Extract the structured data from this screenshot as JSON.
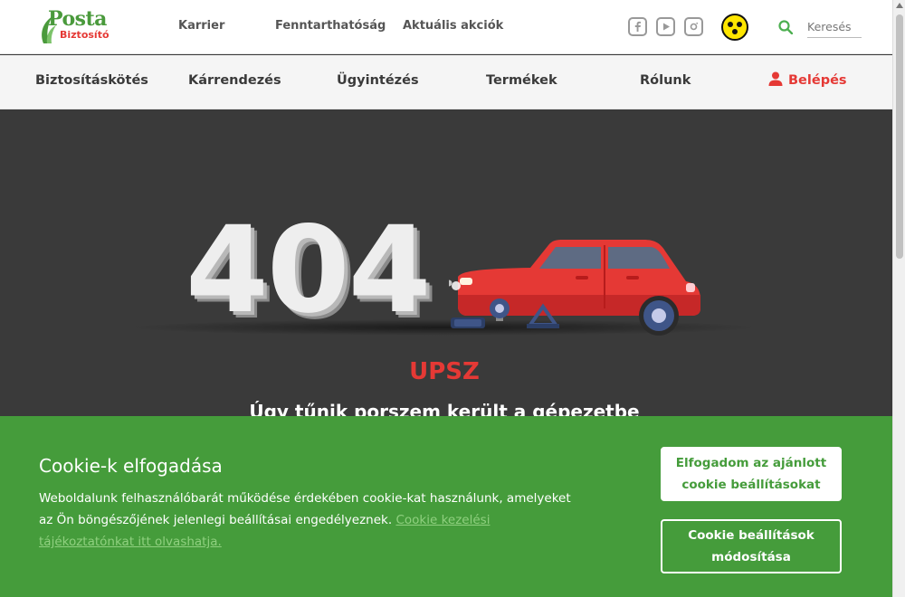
{
  "header": {
    "logo_text": "Posta",
    "logo_sub": "Biztosító",
    "top_links": [
      "Karrier",
      "Fenntarthatóság",
      "Aktuális akciók"
    ],
    "social_icons": [
      "facebook-icon",
      "youtube-icon",
      "instagram-icon"
    ],
    "search_placeholder": "Keresés"
  },
  "nav": {
    "items": [
      "Biztosításkötés",
      "Kárrendezés",
      "Ügyintézés",
      "Termékek",
      "Rólunk"
    ],
    "login": "Belépés"
  },
  "hero": {
    "code": "404",
    "title": "UPSZ",
    "subtitle": "Úgy tűnik porszem került a gépezetbe"
  },
  "cookie": {
    "title": "Cookie-k elfogadása",
    "text": "Weboldalunk felhasználóbarát működése érdekében cookie-kat használunk, amelyeket az Ön böngészőjének jelenlegi beállításai engedélyeznek. ",
    "link": "Cookie kezelési tájékoztatónkat itt olvashatja.",
    "accept_button": "Elfogadom az ajánlott cookie beállításokat",
    "settings_button": "Cookie beállítások módosítása"
  },
  "colors": {
    "brand_green": "#459c3b",
    "accent_red": "#e53935",
    "hero_bg": "#3a3a3a"
  }
}
